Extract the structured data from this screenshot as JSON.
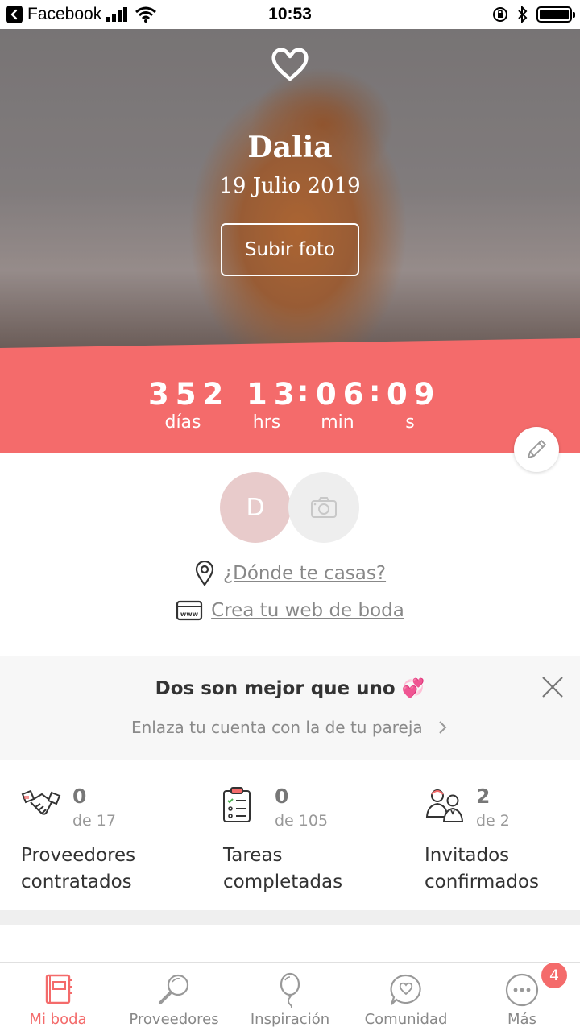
{
  "status_bar": {
    "back_app": "Facebook",
    "time": "10:53"
  },
  "hero": {
    "name": "Dalia",
    "date": "19 Julio 2019",
    "upload_button": "Subir foto"
  },
  "countdown": {
    "days": "352",
    "hours": "13",
    "minutes": "06",
    "seconds": "09",
    "days_label": "días",
    "hours_label": "hrs",
    "minutes_label": "min",
    "seconds_label": "s",
    "separator": ":"
  },
  "profile": {
    "avatar_initial": "D",
    "location_link": "¿Dónde te casas?",
    "website_link": "Crea tu web de boda"
  },
  "partner_card": {
    "title": "Dos son mejor que uno 💞",
    "subtitle": "Enlaza tu cuenta con la de tu pareja"
  },
  "stats": [
    {
      "value": "0",
      "of": "de 17",
      "label_line1": "Proveedores",
      "label_line2": "contratados"
    },
    {
      "value": "0",
      "of": "de 105",
      "label_line1": "Tareas",
      "label_line2": "completadas"
    },
    {
      "value": "2",
      "of": "de 2",
      "label_line1": "Invitados",
      "label_line2": "confirmados"
    }
  ],
  "tabbar": {
    "items": [
      {
        "label": "Mi boda"
      },
      {
        "label": "Proveedores"
      },
      {
        "label": "Inspiración"
      },
      {
        "label": "Comunidad"
      },
      {
        "label": "Más"
      }
    ],
    "more_badge": "4"
  },
  "colors": {
    "accent": "#f46b6b",
    "avatar_bg": "#e8cbcb"
  }
}
